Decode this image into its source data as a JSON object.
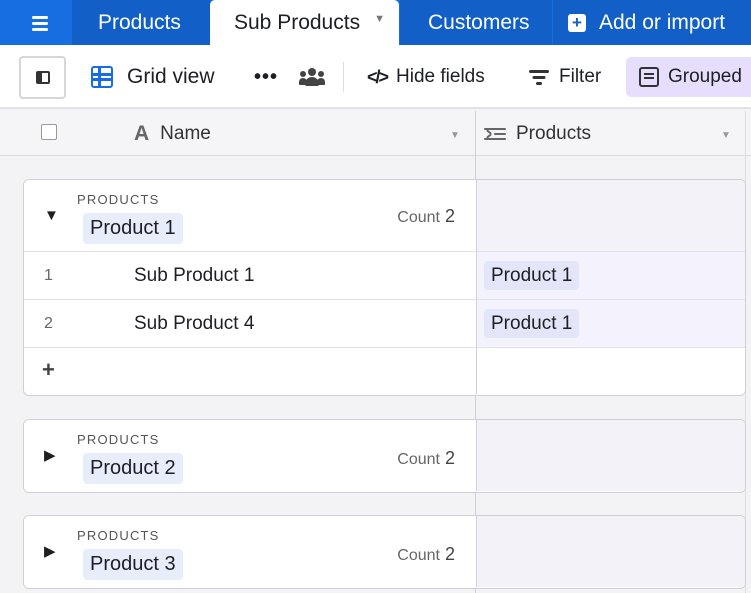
{
  "tabs": [
    {
      "label": "Products",
      "active": false
    },
    {
      "label": "Sub Products",
      "active": true
    },
    {
      "label": "Customers",
      "active": false
    }
  ],
  "add_import_label": "Add or import",
  "toolbar": {
    "view_name": "Grid view",
    "more_icon": "ellipsis-icon",
    "collaborators_icon": "people-icon",
    "hide_fields_label": "Hide fields",
    "filter_label": "Filter",
    "grouped_label": "Grouped"
  },
  "columns": {
    "name": {
      "label": "Name",
      "icon": "text-field-icon"
    },
    "products": {
      "label": "Products",
      "icon": "linked-record-icon"
    }
  },
  "groups": [
    {
      "field_label": "PRODUCTS",
      "value": "Product 1",
      "count_label": "Count",
      "count": "2",
      "expanded": true,
      "rows": [
        {
          "num": "1",
          "name": "Sub Product 1",
          "product": "Product 1"
        },
        {
          "num": "2",
          "name": "Sub Product 4",
          "product": "Product 1"
        }
      ],
      "add_row": "+"
    },
    {
      "field_label": "PRODUCTS",
      "value": "Product 2",
      "count_label": "Count",
      "count": "2",
      "expanded": false
    },
    {
      "field_label": "PRODUCTS",
      "value": "Product 3",
      "count_label": "Count",
      "count": "2",
      "expanded": false
    }
  ],
  "colors": {
    "brand": "#166ee1",
    "tab_dark": "#1260c7",
    "grouped_bg": "#e6defc",
    "chip_bg": "#e8edfb"
  }
}
